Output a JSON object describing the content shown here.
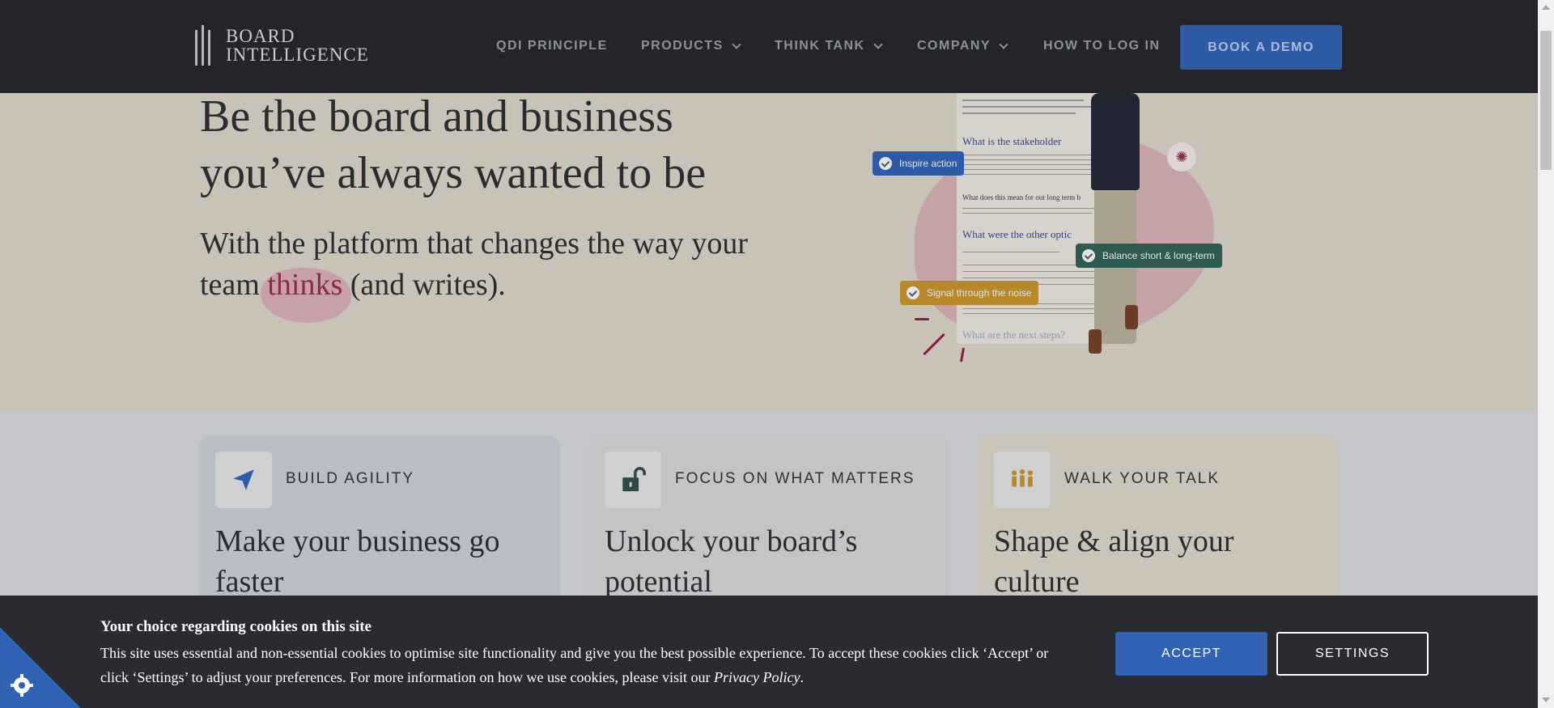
{
  "header": {
    "logo": {
      "line1": "BOARD",
      "line2": "INTELLIGENCE"
    },
    "nav": [
      {
        "label": "QDI PRINCIPLE",
        "dropdown": false
      },
      {
        "label": "PRODUCTS",
        "dropdown": true
      },
      {
        "label": "THINK TANK",
        "dropdown": true
      },
      {
        "label": "COMPANY",
        "dropdown": true
      },
      {
        "label": "HOW TO LOG IN",
        "dropdown": false
      }
    ],
    "cta": "BOOK A DEMO"
  },
  "hero": {
    "title": "Be the board and business you’ve always wanted to be",
    "subtitle_before": "With the platform that changes the way your team ",
    "subtitle_highlight": "thinks",
    "subtitle_after": " (and writes).",
    "illustration": {
      "doc_headings": [
        "What is the stakeholder",
        "What does this mean for our long term b",
        "What were the other optic",
        "What are the next steps?"
      ],
      "pills": [
        {
          "label": "Inspire action",
          "color": "#2f5ba6"
        },
        {
          "label": "Balance short & long-term",
          "color": "#2e5a52"
        },
        {
          "label": "Signal through the noise",
          "color": "#b8892a"
        }
      ],
      "icon": "lightbulb-icon"
    }
  },
  "cards": [
    {
      "label": "BUILD AGILITY",
      "title": "Make your business go faster",
      "icon": "paper-plane-icon",
      "bg": "#b9bdc6",
      "icon_color": "#2f5ba6"
    },
    {
      "label": "FOCUS ON WHAT MATTERS",
      "title": "Unlock your board’s potential",
      "icon": "unlock-icon",
      "bg": "#c3c4c6",
      "icon_color": "#2e4a45"
    },
    {
      "label": "WALK YOUR TALK",
      "title": "Shape & align your culture",
      "icon": "team-icon",
      "bg": "#cbc5b9",
      "icon_color": "#b8892a"
    }
  ],
  "cookie": {
    "title": "Your choice regarding cookies on this site",
    "text": "This site uses essential and non-essential cookies to optimise site functionality and give you the best possible experience. To accept these cookies click ‘Accept’ or click ‘Settings’ to adjust your preferences. For more information on how we use cookies, please visit our ",
    "link": "Privacy Policy",
    "text_end": ".",
    "accept": "ACCEPT",
    "settings": "SETTINGS",
    "corner_icon": "cookie-settings-icon"
  }
}
